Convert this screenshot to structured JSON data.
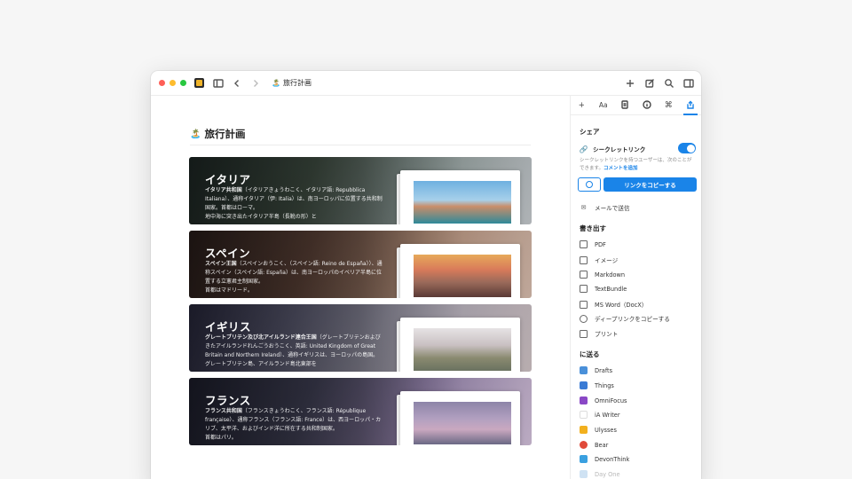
{
  "window": {
    "doc_title": "旅行計画",
    "emoji": "🏝️"
  },
  "page": {
    "heading": "旅行計画",
    "emoji": "🏝️"
  },
  "cards": [
    {
      "title": "イタリア",
      "text_bold": "イタリア共和国",
      "text": "（イタリアきょうわこく、イタリア語: Repubblica Italiana）、通称イタリア（伊: Italia）は、南ヨーロッパに位置する共和制国家。首都はローマ。",
      "text2": "地中海に突き出たイタリア半島（長靴の形）と"
    },
    {
      "title": "スペイン",
      "text_bold": "スペイン王国",
      "text": "（スペインおうこく、（スペイン語: Reino de España））、通称スペイン（スペイン語: España）は、南ヨーロッパのイベリア半島に位置する立憲君主制国家。",
      "text2": "首都はマドリード。"
    },
    {
      "title": "イギリス",
      "text_bold": "グレートブリテン及び北アイルランド連合王国",
      "text": "（グレートブリテンおよびきたアイルランドれんごうおうこく、英語: United Kingdom of Great Britain and Northern Ireland）、通称イギリスは、ヨーロッパの島国。",
      "text2": "グレートブリテン島、アイルランド島北東部を"
    },
    {
      "title": "フランス",
      "text_bold": "フランス共和国",
      "text": "（フランスきょうわこく、フランス語: République française）、通称フランス（フランス語: France）は、西ヨーロッパ・カリブ、太平洋、およびインド洋に所在する共和制国家。",
      "text2": "首都はパリ。"
    }
  ],
  "sidebar": {
    "tabs": [
      "+",
      "Aa",
      "doc",
      "info",
      "cmd",
      "share"
    ],
    "share_title": "シェア",
    "secret_link_label": "シークレットリンク",
    "secret_link_on": true,
    "secret_desc": "シークレットリンクを持つユーザーは、次のことができます。",
    "secret_desc_link": "コメントを追加",
    "copy_link_button": "リンクをコピーする",
    "email_label": "メールで送信",
    "export_title": "書き出す",
    "export_items": [
      "PDF",
      "イメージ",
      "Markdown",
      "TextBundle",
      "MS Word（DocX）",
      "ディープリンクをコピーする",
      "プリント"
    ],
    "send_title": "に送る",
    "send_items": [
      "Drafts",
      "Things",
      "OmniFocus",
      "iA Writer",
      "Ulysses",
      "Bear",
      "DevonThink",
      "Day One"
    ]
  },
  "colors": {
    "accent": "#1a84e8"
  }
}
